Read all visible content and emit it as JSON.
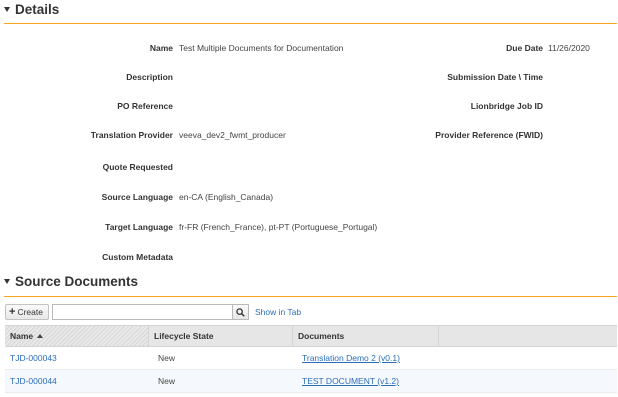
{
  "details": {
    "header": "Details",
    "fields_left": [
      {
        "label": "Name",
        "value": "Test Multiple Documents for Documentation"
      },
      {
        "label": "Description",
        "value": ""
      },
      {
        "label": "PO Reference",
        "value": ""
      },
      {
        "label": "Translation Provider",
        "value": "veeva_dev2_fwmt_producer"
      },
      {
        "label": "Quote Requested",
        "value": ""
      },
      {
        "label": "Source Language",
        "value": "en-CA (English_Canada)"
      },
      {
        "label": "Target Language",
        "value": "fr-FR (French_France), pt-PT (Portuguese_Portugal)"
      },
      {
        "label": "Custom Metadata",
        "value": ""
      }
    ],
    "fields_right": [
      {
        "label": "Due Date",
        "value": "11/26/2020"
      },
      {
        "label": "Submission Date \\ Time",
        "value": ""
      },
      {
        "label": "Lionbridge Job ID",
        "value": ""
      },
      {
        "label": "Provider Reference (FWID)",
        "value": ""
      }
    ]
  },
  "source_documents": {
    "header": "Source Documents",
    "create_label": "Create",
    "search_placeholder": "",
    "show_in_tab": "Show in Tab",
    "columns": [
      "Name",
      "Lifecycle State",
      "Documents"
    ],
    "rows": [
      {
        "name": "TJD-000043",
        "state": "New",
        "document": "Translation Demo 2 (v0.1)"
      },
      {
        "name": "TJD-000044",
        "state": "New",
        "document": "TEST DOCUMENT (v1.2)"
      }
    ]
  },
  "colors": {
    "accent": "#f7a61b",
    "link": "#2a6ebb"
  }
}
